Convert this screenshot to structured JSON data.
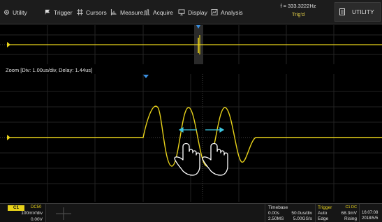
{
  "menu": {
    "items": [
      {
        "label": "Utility",
        "icon": "gear-icon"
      },
      {
        "label": "Trigger",
        "icon": "trigger-flag-icon"
      },
      {
        "label": "Cursors",
        "icon": "cursors-grid-icon"
      },
      {
        "label": "Measure",
        "icon": "measure-icon"
      },
      {
        "label": "Acquire",
        "icon": "acquire-icon"
      },
      {
        "label": "Display",
        "icon": "monitor-icon"
      },
      {
        "label": "Analysis",
        "icon": "analysis-icon"
      }
    ],
    "frequency": "f = 333.3222Hz",
    "trigger_status": "Trig'd",
    "utility_button": "UTILITY"
  },
  "zoom": {
    "label": "Zoom [Div: 1.00us/div,  Delay: 1.44us]"
  },
  "channel": {
    "name": "C1",
    "coupling": "DC50",
    "scale": "100mV/div",
    "offset": "0.00V",
    "color": "#e8d21a"
  },
  "timebase": {
    "title": "Timebase",
    "delay": "0.00s",
    "scale": "50.0us/div",
    "sample_points": "2.50MS",
    "sample_rate": "5.00GS/s"
  },
  "trigger": {
    "title": "Trigger",
    "source": "C1 DC",
    "mode": "Auto",
    "level": "68.3mV",
    "type": "Edge",
    "slope": "Rising"
  },
  "datetime": {
    "time": "16:07:08",
    "date": "2018/5/5"
  },
  "colors": {
    "trace": "#e8d21a",
    "accent": "#3a8fe0",
    "gesture_arrow": "#3ec6e0",
    "trigger_text": "#e8d44a"
  }
}
